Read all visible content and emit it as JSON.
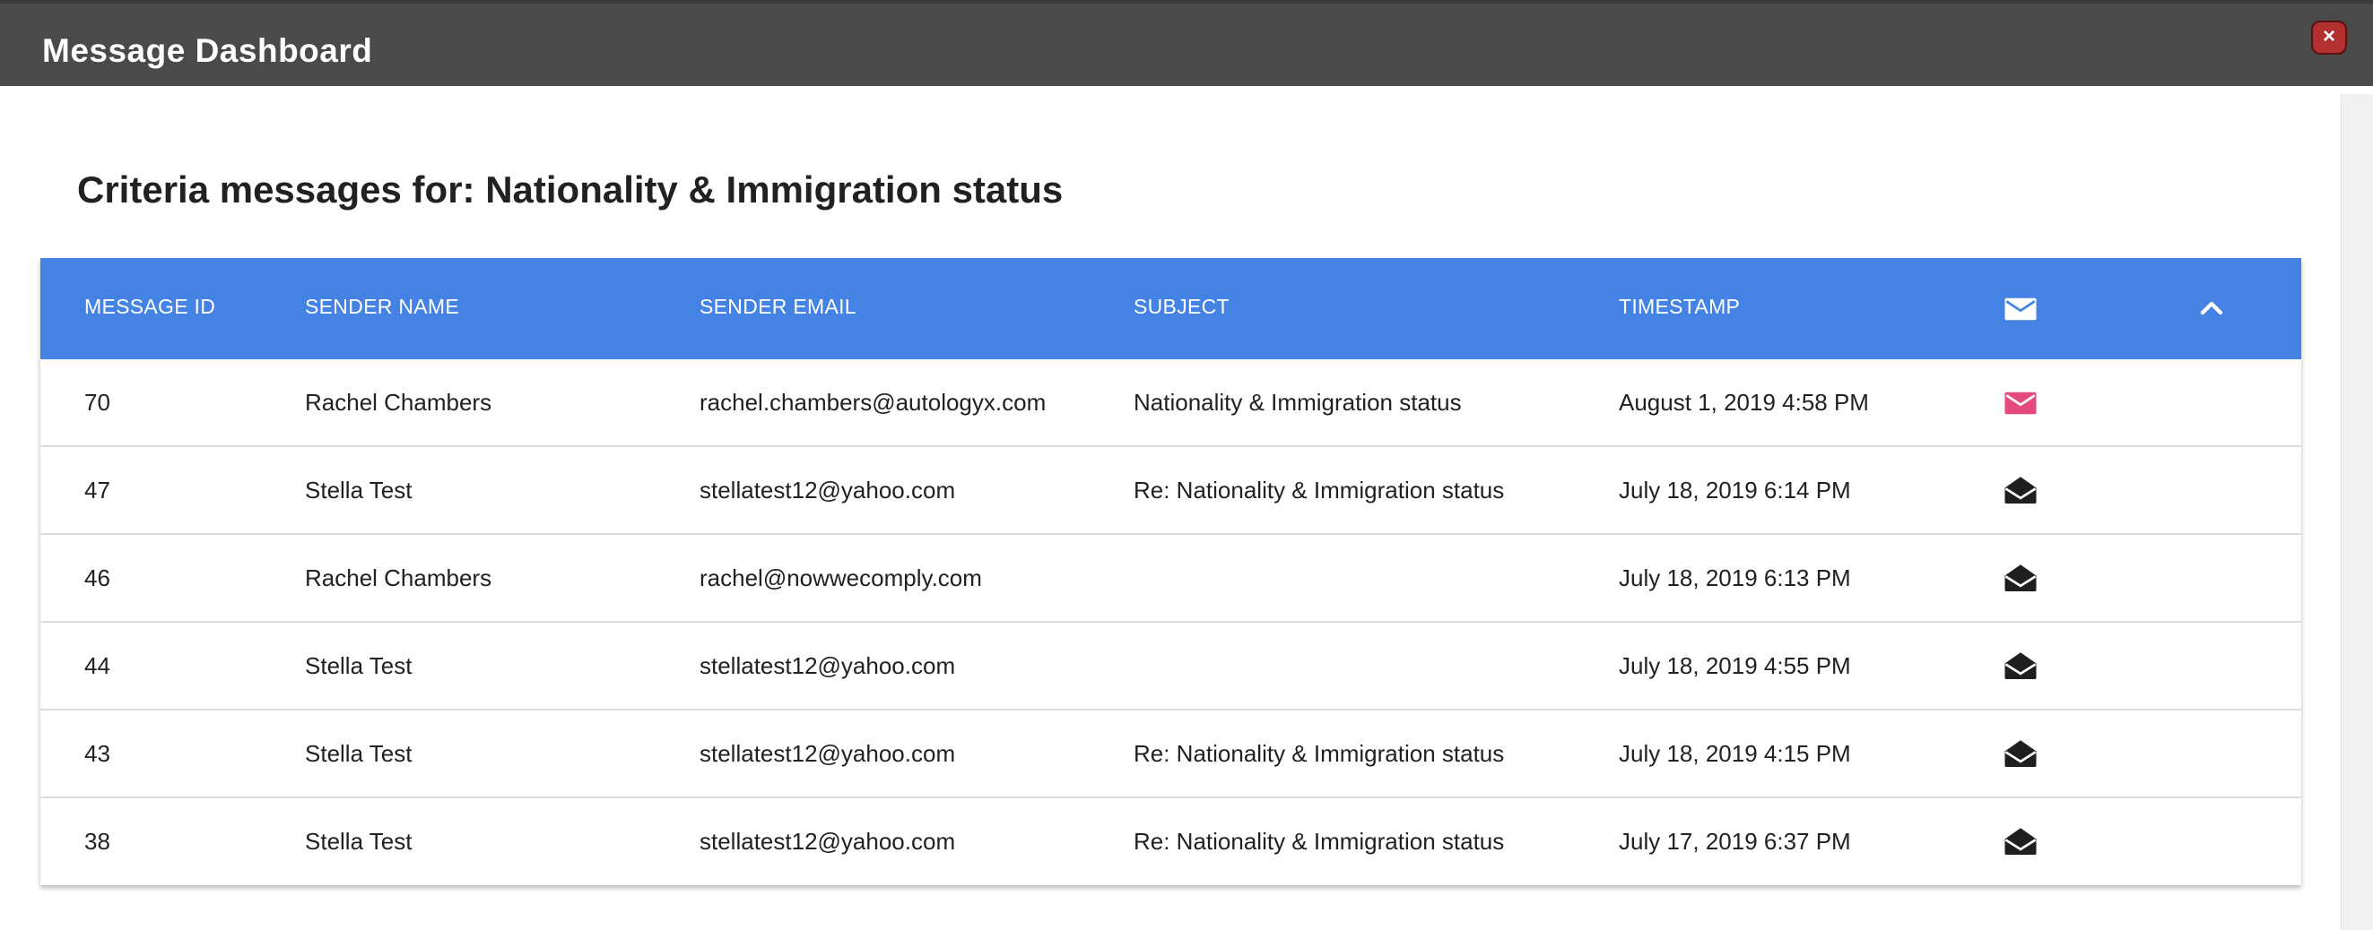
{
  "window": {
    "title": "Message Dashboard",
    "close_label": "×"
  },
  "heading": "Criteria messages for: Nationality & Immigration status",
  "table": {
    "columns": {
      "message_id": "MESSAGE ID",
      "sender_name": "SENDER NAME",
      "sender_email": "SENDER EMAIL",
      "subject": "SUBJECT",
      "timestamp": "TIMESTAMP"
    },
    "header_icons": {
      "status": "envelope-closed-icon",
      "collapse": "chevron-up-icon"
    },
    "rows": [
      {
        "id": "70",
        "name": "Rachel Chambers",
        "email": "rachel.chambers@autologyx.com",
        "subject": "Nationality & Immigration status",
        "timestamp": "August 1, 2019 4:58 PM",
        "status_icon": "envelope-unread-icon",
        "status_color": "#e4497f"
      },
      {
        "id": "47",
        "name": "Stella Test",
        "email": "stellatest12@yahoo.com",
        "subject": "Re: Nationality & Immigration status",
        "timestamp": "July 18, 2019 6:14 PM",
        "status_icon": "envelope-open-icon",
        "status_color": "#1f1f1f"
      },
      {
        "id": "46",
        "name": "Rachel Chambers",
        "email": "rachel@nowwecomply.com",
        "subject": "",
        "timestamp": "July 18, 2019 6:13 PM",
        "status_icon": "envelope-open-icon",
        "status_color": "#1f1f1f"
      },
      {
        "id": "44",
        "name": "Stella Test",
        "email": "stellatest12@yahoo.com",
        "subject": "",
        "timestamp": "July 18, 2019 4:55 PM",
        "status_icon": "envelope-open-icon",
        "status_color": "#1f1f1f"
      },
      {
        "id": "43",
        "name": "Stella Test",
        "email": "stellatest12@yahoo.com",
        "subject": "Re: Nationality & Immigration status",
        "timestamp": "July 18, 2019 4:15 PM",
        "status_icon": "envelope-open-icon",
        "status_color": "#1f1f1f"
      },
      {
        "id": "38",
        "name": "Stella Test",
        "email": "stellatest12@yahoo.com",
        "subject": "Re: Nationality & Immigration status",
        "timestamp": "July 17, 2019 6:37 PM",
        "status_icon": "envelope-open-icon",
        "status_color": "#1f1f1f"
      }
    ]
  },
  "colors": {
    "titlebar": "#4a4a4a",
    "table_header": "#4482e4",
    "unread": "#e4497f",
    "read": "#1f1f1f",
    "close_button": "#b23030"
  }
}
